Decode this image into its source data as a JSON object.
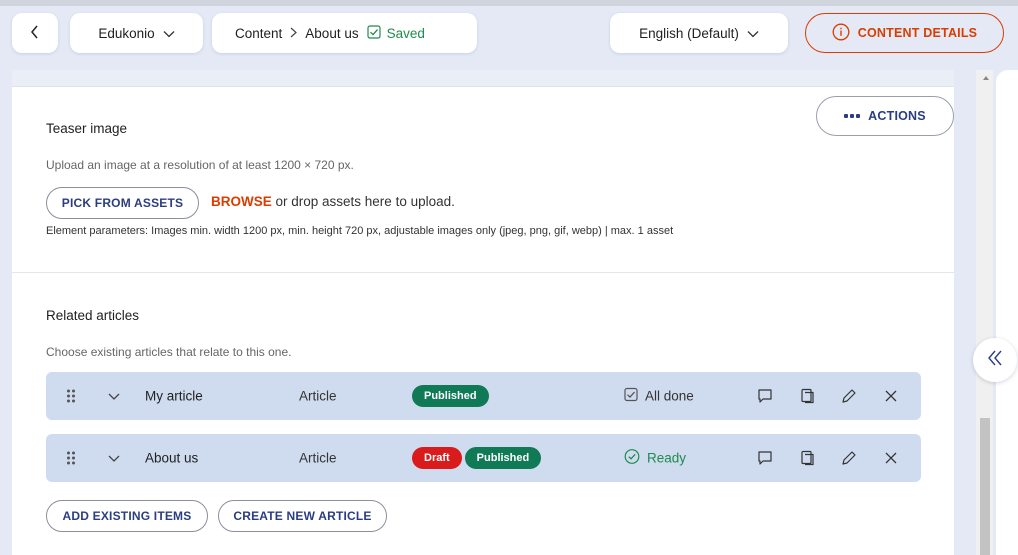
{
  "topbar": {
    "project": "Edukonio",
    "breadcrumb": [
      "Content",
      "About us"
    ],
    "saved_label": "Saved",
    "language": "English (Default)",
    "content_details_label": "CONTENT DETAILS"
  },
  "actions_label": "ACTIONS",
  "teaser": {
    "title": "Teaser image",
    "hint": "Upload an image at a resolution of at least 1200 × 720 px.",
    "pick_label": "PICK FROM ASSETS",
    "browse_label": "BROWSE",
    "drop_text": " or drop assets here to upload.",
    "params": "Element parameters: Images min. width 1200 px, min. height 720 px, adjustable images only (jpeg, png, gif, webp) | max. 1 asset"
  },
  "related": {
    "title": "Related articles",
    "hint": "Choose existing articles that relate to this one.",
    "items": [
      {
        "name": "My article",
        "type": "Article",
        "badges": [
          "Published"
        ],
        "status": "All done"
      },
      {
        "name": "About us",
        "type": "Article",
        "badges": [
          "Draft",
          "Published"
        ],
        "status": "Ready"
      }
    ],
    "add_existing_label": "ADD EXISTING ITEMS",
    "create_new_label": "CREATE NEW ARTICLE"
  },
  "colors": {
    "accent": "#db3c00",
    "primary_text": "#2b3d82",
    "published": "#0f7a55",
    "draft": "#da1b1b",
    "ready": "#1f8a4c",
    "row_bg": "#cfdcf0"
  },
  "icons": [
    "back-icon",
    "chevron-down-icon",
    "chevron-right-icon",
    "checkbox-icon",
    "info-icon",
    "dots-icon",
    "drag-handle-icon",
    "comment-icon",
    "duplicate-icon",
    "edit-icon",
    "close-icon",
    "check-circle-icon",
    "double-chevron-left-icon"
  ]
}
